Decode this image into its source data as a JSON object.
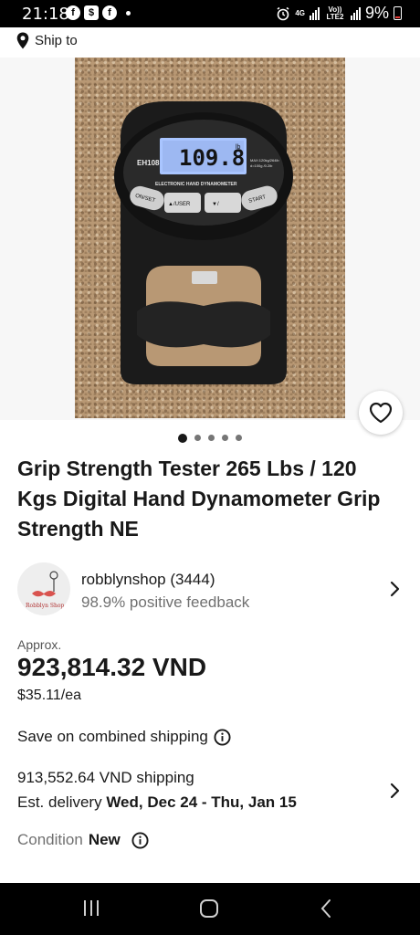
{
  "status_bar": {
    "time": "21:18",
    "apps": [
      "facebook-icon",
      "shop-icon",
      "facebook-icon"
    ],
    "network_4g": "4G",
    "volte": "Vo)) LTE2",
    "battery": "9%"
  },
  "header": {
    "ship_to": "Ship to"
  },
  "gallery": {
    "device_model": "EH108",
    "lcd_value": "109.8",
    "lcd_unit": "lb",
    "device_label": "ELECTRONIC HAND DYNAMOMETER",
    "max_text": "MAX:120kg/264lb",
    "div_text": "d=100g /0.2lb",
    "btn_onset": "ON/SET",
    "btn_user": "▲/USER",
    "btn_down": "▼/",
    "btn_start": "START",
    "image_count": 5,
    "active_index": 0
  },
  "listing": {
    "title": "Grip Strength Tester 265 Lbs / 120 Kgs Digital Hand Dynamometer Grip Strength NE"
  },
  "seller": {
    "name": "robblynshop (3444)",
    "feedback": "98.9% positive feedback",
    "avatar_text": "Robblyn Shop"
  },
  "price": {
    "approx_label": "Approx.",
    "local_price": "923,814.32 VND",
    "usd_price": "$35.11/ea"
  },
  "shipping": {
    "combined": "Save on combined shipping",
    "cost": "913,552.64 VND shipping",
    "delivery_label": "Est. delivery ",
    "delivery_dates": "Wed, Dec 24 - Thu, Jan 15"
  },
  "condition": {
    "label": "Condition",
    "value": "New"
  },
  "colors": {
    "text": "#191919",
    "muted": "#707070",
    "device_body": "#1a1a1a",
    "lcd": "#a9c5ff"
  }
}
